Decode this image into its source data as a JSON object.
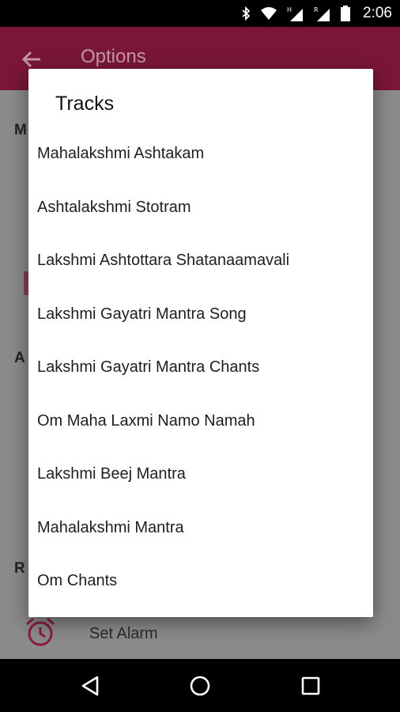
{
  "status_bar": {
    "time": "2:06",
    "icons": [
      "bluetooth-icon",
      "wifi-icon",
      "signal-h-icon",
      "signal-r-icon",
      "battery-icon"
    ]
  },
  "app_bar": {
    "title": "Options",
    "back_icon": "arrow-left-icon"
  },
  "background": {
    "section_letters": [
      "M",
      "A",
      "R"
    ],
    "alarm_label": "Set Alarm",
    "alarm_icon": "alarm-clock-icon",
    "accent_color": "#8a1c40"
  },
  "dialog": {
    "title": "Tracks",
    "tracks": [
      "Mahalakshmi Ashtakam",
      "Ashtalakshmi Stotram",
      "Lakshmi Ashtottara Shatanaamavali",
      "Lakshmi Gayatri Mantra Song",
      "Lakshmi Gayatri Mantra Chants",
      "Om Maha Laxmi Namo Namah",
      "Lakshmi Beej Mantra",
      "Mahalakshmi Mantra",
      "Om Chants"
    ]
  },
  "nav_bar": {
    "buttons": [
      "back-triangle-icon",
      "home-circle-icon",
      "recents-square-icon"
    ]
  },
  "colors": {
    "app_bar": "#7a1638",
    "dim_overlay": "#8a8a8a",
    "dialog_bg": "#ffffff"
  }
}
